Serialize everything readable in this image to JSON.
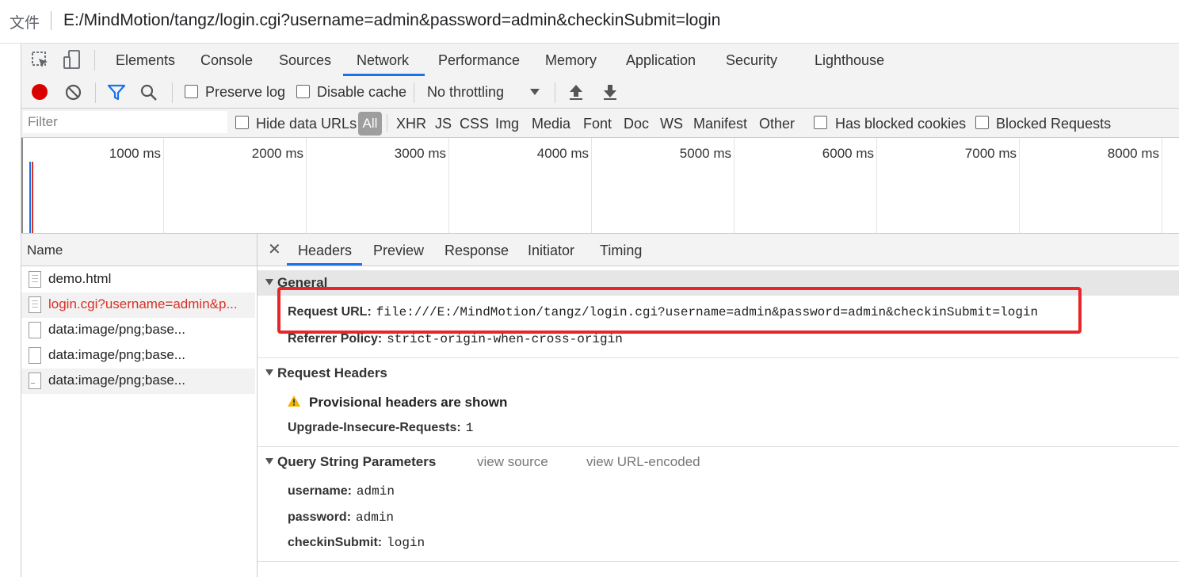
{
  "address_bar": {
    "label": "文件",
    "url": "E:/MindMotion/tangz/login.cgi?username=admin&password=admin&checkinSubmit=login"
  },
  "devtools": {
    "tabs": [
      "Elements",
      "Console",
      "Sources",
      "Network",
      "Performance",
      "Memory",
      "Application",
      "Security",
      "Lighthouse"
    ],
    "active_tab": "Network"
  },
  "toolbar": {
    "preserve_log": "Preserve log",
    "disable_cache": "Disable cache",
    "throttling": "No throttling"
  },
  "filter_bar": {
    "placeholder": "Filter",
    "hide_data_urls": "Hide data URLs",
    "types": [
      "All",
      "XHR",
      "JS",
      "CSS",
      "Img",
      "Media",
      "Font",
      "Doc",
      "WS",
      "Manifest",
      "Other"
    ],
    "has_blocked_cookies": "Has blocked cookies",
    "blocked_requests": "Blocked Requests"
  },
  "overview": {
    "ticks": [
      "1000 ms",
      "2000 ms",
      "3000 ms",
      "4000 ms",
      "5000 ms",
      "6000 ms",
      "7000 ms",
      "8000 ms"
    ]
  },
  "request_list": {
    "header": "Name",
    "rows": [
      {
        "name": "demo.html"
      },
      {
        "name": "login.cgi?username=admin&p..."
      },
      {
        "name": "data:image/png;base..."
      },
      {
        "name": "data:image/png;base..."
      },
      {
        "name": "data:image/png;base..."
      }
    ]
  },
  "details": {
    "tabs": [
      "Headers",
      "Preview",
      "Response",
      "Initiator",
      "Timing"
    ],
    "active_tab": "Headers",
    "general": {
      "title": "General",
      "request_url_key": "Request URL:",
      "request_url_value": "file:///E:/MindMotion/tangz/login.cgi?username=admin&password=admin&checkinSubmit=login",
      "referrer_key": "Referrer Policy:",
      "referrer_value": "strict-origin-when-cross-origin"
    },
    "request_headers": {
      "title": "Request Headers",
      "warning": "Provisional headers are shown",
      "upgrade_key": "Upgrade-Insecure-Requests:",
      "upgrade_value": "1"
    },
    "query": {
      "title": "Query String Parameters",
      "view_source": "view source",
      "view_url_encoded": "view URL-encoded",
      "params": [
        {
          "key": "username:",
          "value": "admin"
        },
        {
          "key": "password:",
          "value": "admin"
        },
        {
          "key": "checkinSubmit:",
          "value": "login"
        }
      ]
    }
  },
  "colors": {
    "accent": "#1a73e8",
    "record": "#d90000",
    "filter_icon": "#1a73e8",
    "highlight_box": "#e8262a",
    "error_row_text": "#d93025"
  }
}
